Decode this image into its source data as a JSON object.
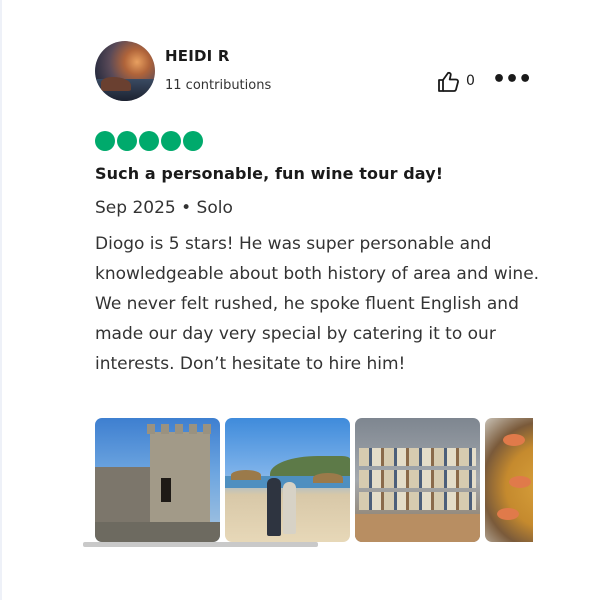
{
  "reviewer": {
    "name": "HEIDI R",
    "contributions": "11 contributions"
  },
  "actions": {
    "like_count": "0",
    "like_icon": "thumbs-up-icon",
    "more_icon": "more-options-icon"
  },
  "rating": {
    "value": 5,
    "max": 5,
    "color": "#00aa6c"
  },
  "review": {
    "title": "Such a personable, fun wine tour day!",
    "meta": "Sep 2025 • Solo",
    "body": "Diogo is 5 stars! He was super personable and knowledgeable about both history of area and wine. We never felt rushed, he spoke fluent English and made our day very special by catering it to our interests. Don’t hesitate to hire him!"
  },
  "photos": [
    {
      "subject": "castle"
    },
    {
      "subject": "beach-couple"
    },
    {
      "subject": "tile-shop"
    },
    {
      "subject": "paella"
    }
  ],
  "colors": {
    "text": "#333333",
    "heading": "#1a1a1a",
    "bubble_green": "#00aa6c",
    "scrollbar": "#c9c9c9"
  }
}
